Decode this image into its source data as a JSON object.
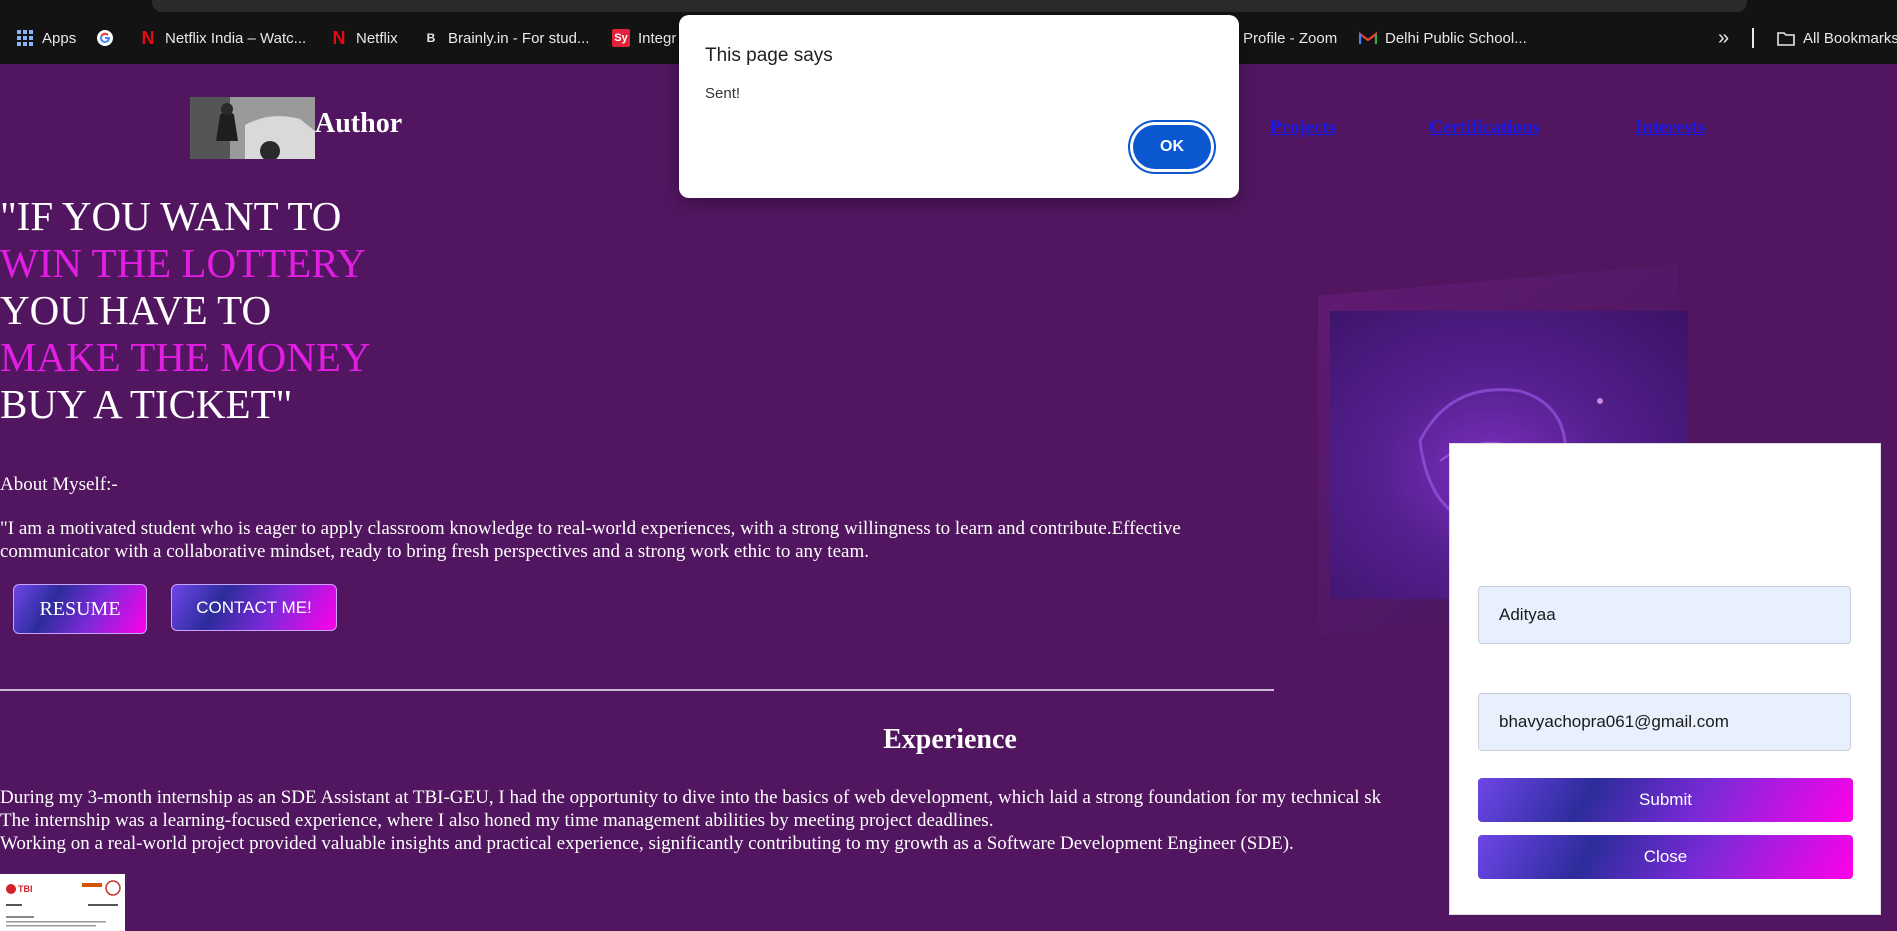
{
  "bookmarks": {
    "apps_label": "Apps",
    "items": [
      {
        "label": "Netflix India – Watc..."
      },
      {
        "label": "Netflix"
      },
      {
        "label": "Brainly.in - For stud..."
      },
      {
        "label": "Integr"
      },
      {
        "label": "Profile - Zoom"
      },
      {
        "label": "Delhi Public School..."
      }
    ],
    "overflow_label": "»",
    "all_bookmarks_label": "All Bookmarks"
  },
  "header": {
    "brand": "Author",
    "nav": [
      "Projects",
      "Certifications",
      "Interests"
    ]
  },
  "hero": {
    "lines": [
      "\"IF YOU WANT TO",
      "WIN THE LOTTERY",
      "YOU HAVE TO",
      "MAKE THE MONEY",
      "BUY A TICKET\""
    ],
    "accent_color": "#e31ee3"
  },
  "about": {
    "heading": "About Myself:-",
    "text": "\"I am a motivated student who is eager to apply classroom knowledge to real-world experiences, with a strong willingness to learn and contribute.Effective communicator with a collaborative mindset, ready to bring fresh perspectives and a strong work ethic to any team.",
    "resume_label": "RESUME",
    "contact_label": "CONTACT ME!"
  },
  "experience": {
    "heading": "Experience",
    "lines": [
      "During my 3-month internship as an SDE Assistant at TBI-GEU, I had the opportunity to dive into the basics of web development, which laid a strong foundation for my technical sk",
      "The internship was a learning-focused experience, where I also honed my time management abilities by meeting project deadlines.",
      "Working on a real-world project provided valuable insights and practical experience, significantly contributing to my growth as a Software Development Engineer (SDE)."
    ],
    "certificate_logo": "TBI"
  },
  "form": {
    "name_value": "Adityaa",
    "email_value": "bhavyachopra061@gmail.com",
    "submit_label": "Submit",
    "close_label": "Close"
  },
  "dialog": {
    "title": "This page says",
    "message": "Sent!",
    "ok_label": "OK"
  },
  "colors": {
    "page_bg": "#521660",
    "accent_pink": "#e31ee3",
    "dialog_button": "#0b57d0"
  }
}
